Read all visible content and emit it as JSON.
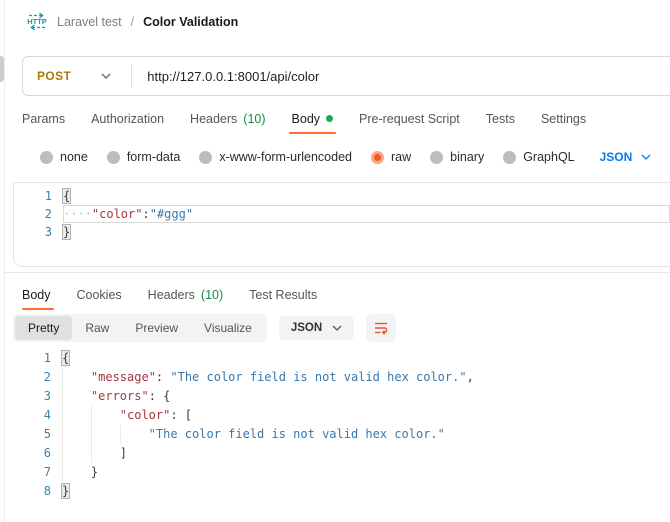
{
  "colors": {
    "accent_orange": "#FF6C37",
    "method_post": "#AD7A03",
    "link_blue": "#097BED",
    "headers_count_green": "#188A42",
    "body_dot_green": "#19A84C",
    "code_key_red": "#A8353E",
    "code_string_blue": "#3876AD",
    "line_number_blue": "#3D80A6"
  },
  "breadcrumb": {
    "collection": "Laravel test",
    "divider": "/",
    "request": "Color Validation"
  },
  "request_bar": {
    "method": "POST",
    "url": "http://127.0.0.1:8001/api/color"
  },
  "request_tabs": [
    {
      "id": "params",
      "label": "Params"
    },
    {
      "id": "authorization",
      "label": "Authorization"
    },
    {
      "id": "headers",
      "label": "Headers",
      "count": "(10)"
    },
    {
      "id": "body",
      "label": "Body",
      "active": true,
      "dot": true
    },
    {
      "id": "pre-request-script",
      "label": "Pre-request Script"
    },
    {
      "id": "tests",
      "label": "Tests"
    },
    {
      "id": "settings",
      "label": "Settings"
    }
  ],
  "body_type_options": [
    {
      "id": "none",
      "label": "none"
    },
    {
      "id": "form-data",
      "label": "form-data"
    },
    {
      "id": "x-www-form-urlencoded",
      "label": "x-www-form-urlencoded"
    },
    {
      "id": "raw",
      "label": "raw",
      "selected": true
    },
    {
      "id": "binary",
      "label": "binary"
    },
    {
      "id": "graphql",
      "label": "GraphQL"
    }
  ],
  "raw_language_select": "JSON",
  "request_editor": {
    "lines": [
      {
        "n": "1",
        "indent": 0,
        "tokens": [
          [
            "bracket",
            "{"
          ]
        ]
      },
      {
        "n": "2",
        "indent": 0,
        "active": true,
        "tokens": [
          [
            "ws",
            "····"
          ],
          [
            "key",
            "\"color\""
          ],
          [
            "punct",
            ":"
          ],
          [
            "string",
            "\"#ggg\""
          ]
        ]
      },
      {
        "n": "3",
        "indent": 0,
        "tokens": [
          [
            "bracket",
            "}"
          ]
        ]
      }
    ]
  },
  "response_tabs": [
    {
      "id": "body",
      "label": "Body",
      "active": true
    },
    {
      "id": "cookies",
      "label": "Cookies"
    },
    {
      "id": "headers",
      "label": "Headers",
      "count": "(10)"
    },
    {
      "id": "test-results",
      "label": "Test Results"
    }
  ],
  "response_toolbar": {
    "views": [
      {
        "id": "pretty",
        "label": "Pretty",
        "active": true
      },
      {
        "id": "raw",
        "label": "Raw"
      },
      {
        "id": "preview",
        "label": "Preview"
      },
      {
        "id": "visualize",
        "label": "Visualize"
      }
    ],
    "language": "JSON",
    "wrap_icon": "text-wrap-icon"
  },
  "response_editor": {
    "lines": [
      {
        "n": "1",
        "indent": 0,
        "tokens": [
          [
            "bracket",
            "{"
          ]
        ]
      },
      {
        "n": "2",
        "indent": 1,
        "tokens": [
          [
            "key",
            "\"message\""
          ],
          [
            "punct",
            ": "
          ],
          [
            "string",
            "\"The color field is not valid hex color.\""
          ],
          [
            "punct",
            ","
          ]
        ]
      },
      {
        "n": "3",
        "indent": 1,
        "tokens": [
          [
            "key",
            "\"errors\""
          ],
          [
            "punct",
            ": {"
          ]
        ]
      },
      {
        "n": "4",
        "indent": 2,
        "tokens": [
          [
            "key",
            "\"color\""
          ],
          [
            "punct",
            ": ["
          ]
        ]
      },
      {
        "n": "5",
        "indent": 3,
        "tokens": [
          [
            "string",
            "\"The color field is not valid hex color.\""
          ]
        ]
      },
      {
        "n": "6",
        "indent": 2,
        "tokens": [
          [
            "punct",
            "]"
          ]
        ]
      },
      {
        "n": "7",
        "indent": 1,
        "tokens": [
          [
            "punct",
            "}"
          ]
        ]
      },
      {
        "n": "8",
        "indent": 0,
        "tokens": [
          [
            "bracket",
            "}"
          ]
        ]
      }
    ]
  }
}
